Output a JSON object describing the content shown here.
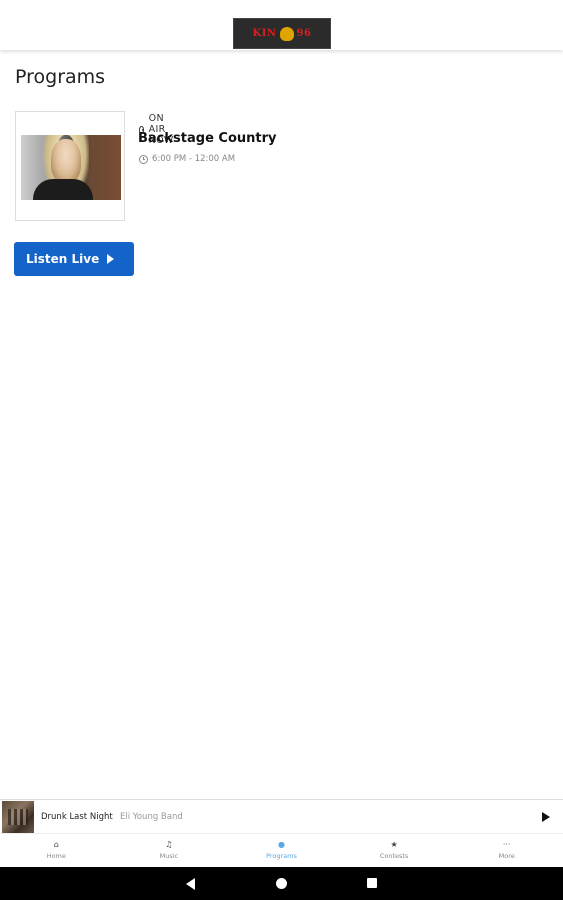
{
  "header": {
    "logo_text_left": "KIN",
    "logo_text_right": "96"
  },
  "page": {
    "title": "Programs"
  },
  "program": {
    "on_air_label": "ON AIR NOW",
    "name": "Backstage Country",
    "time": "6:00 PM - 12:00 AM"
  },
  "listen_button": {
    "label": "Listen Live"
  },
  "now_playing": {
    "title": "Drunk Last Night",
    "artist": "Eli Young Band"
  },
  "tabs": [
    {
      "label": "Home",
      "icon": "home-icon"
    },
    {
      "label": "Music",
      "icon": "music-note-icon"
    },
    {
      "label": "Programs",
      "icon": "microphone-icon"
    },
    {
      "label": "Contests",
      "icon": "star-icon"
    },
    {
      "label": "More",
      "icon": "more-dots-icon"
    }
  ],
  "colors": {
    "accent": "#1363c8",
    "active_tab": "#5aa9e6"
  }
}
